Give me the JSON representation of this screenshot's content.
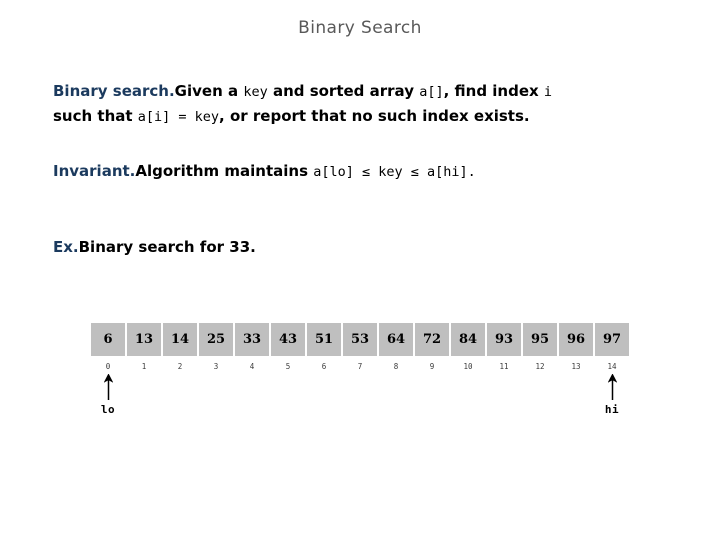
{
  "slide": {
    "title": "Binary Search"
  },
  "definition": {
    "lead": "Binary search.",
    "part1": "Given a ",
    "code1": "key",
    "part2": " and sorted array ",
    "code2": "a[]",
    "part3": ", find index ",
    "code3": "i",
    "part4": "such that ",
    "code4": "a[i] = key",
    "part5": ", or report that no such index exists."
  },
  "invariant": {
    "lead": "Invariant.",
    "text": "Algorithm maintains ",
    "code": "a[lo] ≤ key ≤ a[hi]."
  },
  "example": {
    "lead": "Ex.",
    "text": "Binary search for 33."
  },
  "array": {
    "values": [
      "6",
      "13",
      "14",
      "25",
      "33",
      "43",
      "51",
      "53",
      "64",
      "72",
      "84",
      "93",
      "95",
      "96",
      "97"
    ],
    "indices": [
      "0",
      "1",
      "2",
      "3",
      "4",
      "5",
      "6",
      "7",
      "8",
      "9",
      "10",
      "11",
      "12",
      "13",
      "14"
    ],
    "cell_color": "#bfbfbf",
    "pointers": [
      {
        "label": "lo",
        "index": 0,
        "icon": "up-arrow-icon"
      },
      {
        "label": "hi",
        "index": 14,
        "icon": "up-arrow-icon"
      }
    ]
  },
  "colors": {
    "title": "#595959",
    "accent": "#1b3a5e",
    "text": "#000000",
    "cell": "#bfbfbf"
  }
}
